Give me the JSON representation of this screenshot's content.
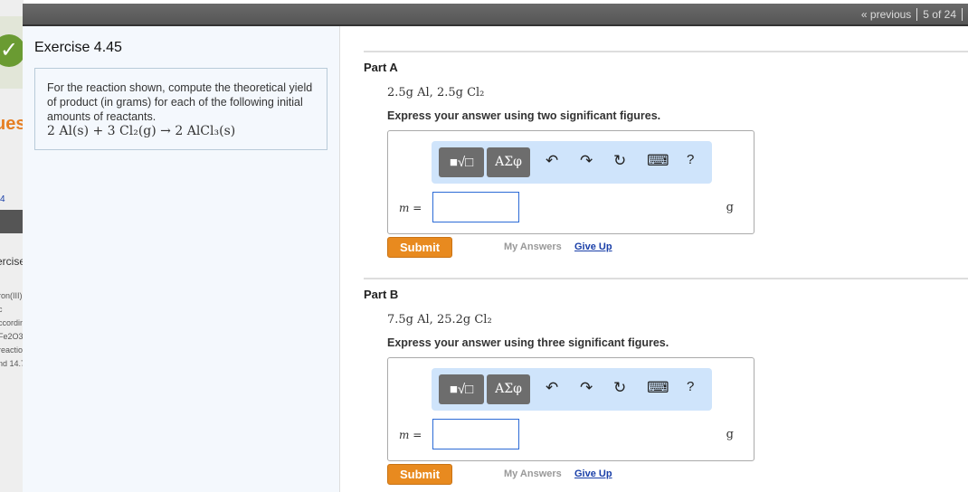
{
  "background": {
    "left_fragments": [
      "ues",
      "4",
      "ercise",
      "ron(III) c",
      "ccordin",
      "Fe2O3(",
      "reactio",
      "nd 14.7"
    ]
  },
  "nav": {
    "previous": "« previous",
    "position": "5 of 24"
  },
  "exercise": {
    "title": "Exercise 4.45",
    "prompt": "For the reaction shown, compute the theoretical yield of product (in grams) for each of the following initial amounts of reactants.",
    "equation": "2 Al(s) + 3 Cl₂(g) → 2 AlCl₃(s)"
  },
  "parts": [
    {
      "title": "Part A",
      "given_text": "2.5g Al, 2.5g Cl₂",
      "instruction": "Express your answer using two significant figures.",
      "var_label": "m =",
      "unit": "g",
      "value": "",
      "submit": "Submit",
      "my_answers": "My Answers",
      "give_up": "Give Up"
    },
    {
      "title": "Part B",
      "given_text": "7.5g Al, 25.2g Cl₂",
      "instruction": "Express your answer using three significant figures.",
      "var_label": "m =",
      "unit": "g",
      "value": "",
      "submit": "Submit",
      "my_answers": "My Answers",
      "give_up": "Give Up"
    }
  ],
  "toolbar": {
    "templates": "■√□",
    "symbols": "ΑΣφ",
    "undo": "↶",
    "redo": "↷",
    "reset": "↻",
    "keyboard": "⌨",
    "help": "?"
  }
}
